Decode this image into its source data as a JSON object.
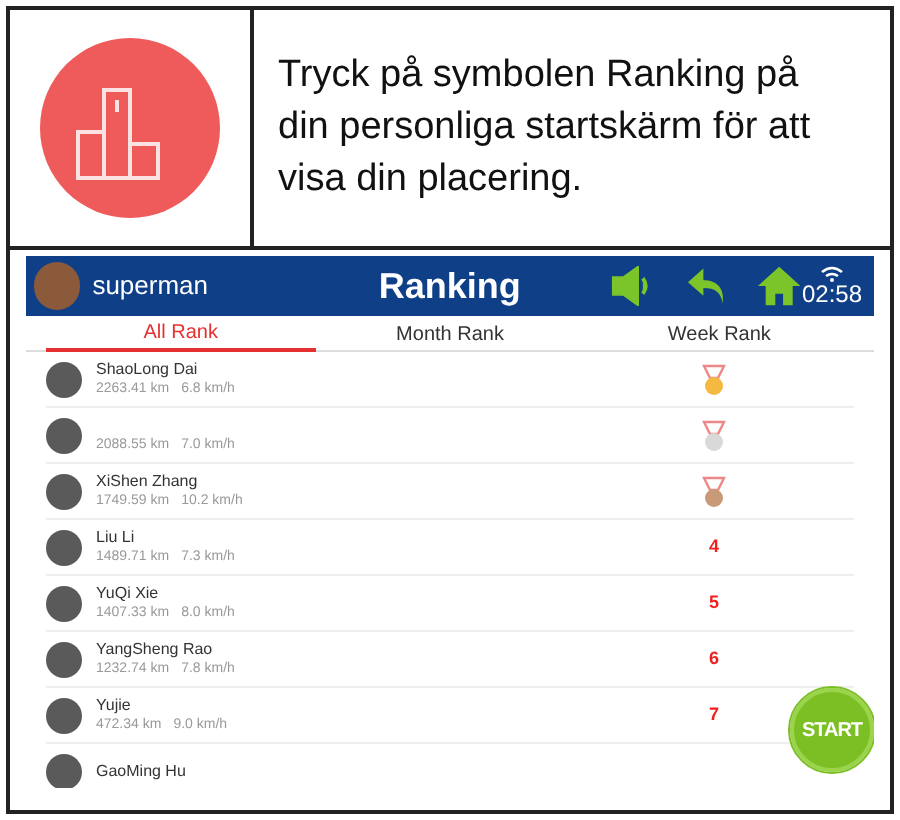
{
  "instruction": "Tryck på symbolen Ranking på din personliga startskärm för att visa din placering.",
  "app": {
    "header": {
      "username": "superman",
      "title": "Ranking",
      "time": "02:58"
    },
    "tabs": [
      {
        "label": "All Rank",
        "selected": true
      },
      {
        "label": "Month Rank",
        "selected": false
      },
      {
        "label": "Week Rank",
        "selected": false
      }
    ],
    "rows": [
      {
        "name": "ShaoLong Dai",
        "distance": "2263.41 km",
        "speed": "6.8 km/h",
        "rank": {
          "kind": "medal",
          "color": "#f5b942"
        }
      },
      {
        "distance": "2088.55 km",
        "speed": "7.0 km/h",
        "rank": {
          "kind": "medal",
          "color": "#d9d9d9"
        }
      },
      {
        "name": "XiShen Zhang",
        "distance": "1749.59 km",
        "speed": "10.2 km/h",
        "rank": {
          "kind": "medal",
          "color": "#c99a78"
        }
      },
      {
        "name": "Liu Li",
        "distance": "1489.71 km",
        "speed": "7.3 km/h",
        "rank": {
          "kind": "number",
          "text": "4"
        }
      },
      {
        "name": "YuQi Xie",
        "distance": "1407.33 km",
        "speed": "8.0 km/h",
        "rank": {
          "kind": "number",
          "text": "5"
        }
      },
      {
        "name": "YangSheng Rao",
        "distance": "1232.74 km",
        "speed": "7.8 km/h",
        "rank": {
          "kind": "number",
          "text": "6"
        }
      },
      {
        "name": "Yujie",
        "distance": "472.34 km",
        "speed": "9.0 km/h",
        "rank": {
          "kind": "number",
          "text": "7"
        }
      },
      {
        "name": "GaoMing Hu"
      }
    ],
    "start_button": "START"
  }
}
